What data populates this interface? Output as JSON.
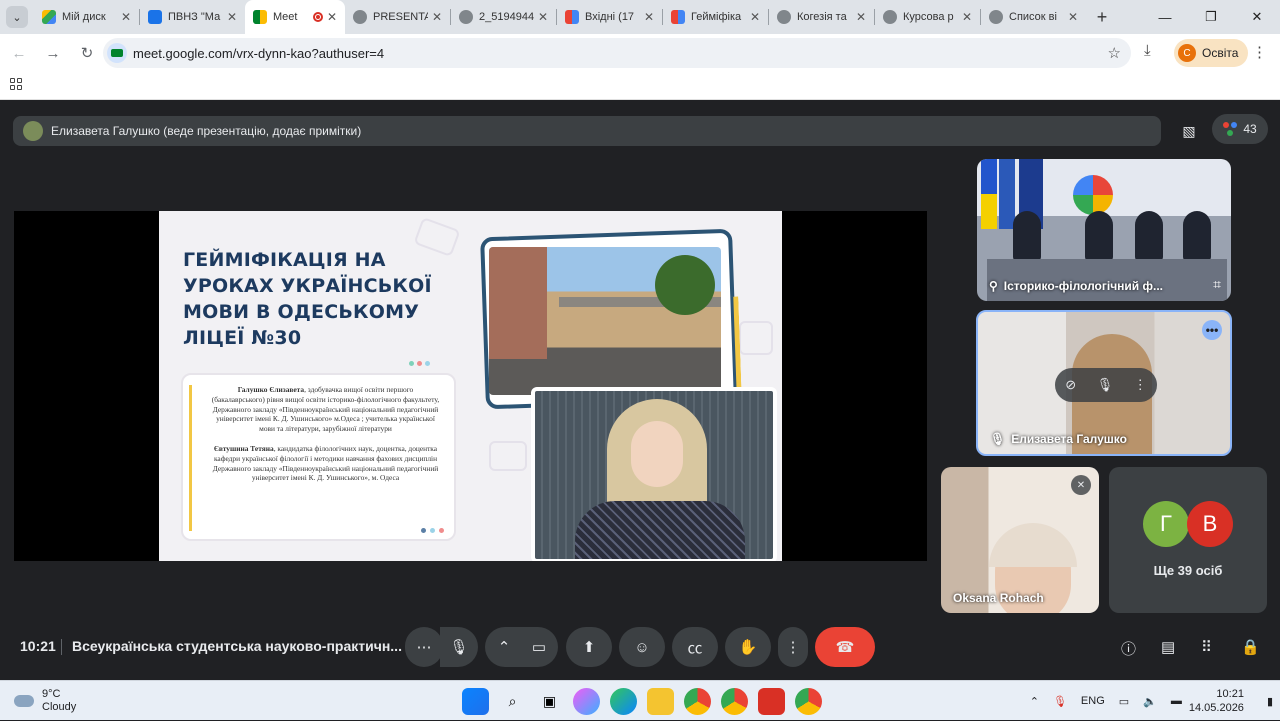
{
  "browser": {
    "tabs": [
      {
        "label": "Мій диск",
        "color": "#34a853"
      },
      {
        "label": "ПВНЗ \"Ма",
        "color": "#1a73e8"
      },
      {
        "label": "Meet",
        "color": "#00832d",
        "active": true
      },
      {
        "label": "PRESENTA",
        "color": "#5f6368"
      },
      {
        "label": "2_5194944",
        "color": "#5f6368"
      },
      {
        "label": "Вхідні (17",
        "color": "#ea4335"
      },
      {
        "label": "Гейміфіка",
        "color": "#ea4335"
      },
      {
        "label": "Когезія та",
        "color": "#5f6368"
      },
      {
        "label": "Курсова р",
        "color": "#5f6368"
      },
      {
        "label": "Список ві",
        "color": "#5f6368"
      }
    ],
    "url": "meet.google.com/vrx-dynn-kao?authuser=4",
    "profile_label": "Освіта",
    "profile_initial": "С"
  },
  "meet": {
    "presenter_banner": "Елизавета Галушко (веде презентацію, додає примітки)",
    "participant_count": "43",
    "slide": {
      "title": "ГЕЙМІФІКАЦІЯ НА УРОКАХ УКРАЇНСЬКОЇ МОВИ В ОДЕСЬКОМУ ЛІЦЕЇ №30",
      "author1_name": "Галушко Єлизавета",
      "author1_text": ", здобувачка вищої освіти першого (бакалаврського) рівня вищої освіти історико-філологічного факультету, Державного закладу «Південноукраїнський національний педагогічний університет імені К. Д. Ушинського» м.Одеса ; учителька української мови та літератури, зарубіжної літератури",
      "author2_name": "Євтушина Тетяна",
      "author2_text": ", кандидатка філологічних наук, доцентка, доцентка кафедри української філології і методики навчання фахових дисциплін Державного закладу «Південноукраїнський національний педагогічний університет імені К. Д. Ушинського», м. Одеса"
    },
    "tiles": {
      "room_name": "Історико-філологічний ф...",
      "speaker_name": "Елизавета Галушко",
      "third_name": "Oksana Rohach",
      "avatar1": "Г",
      "avatar2": "В",
      "more_label": "Ще 39 осіб"
    },
    "time": "10:21",
    "meeting_title": "Всеукраїнська студентська науково-практичн..."
  },
  "taskbar": {
    "temperature": "9°C",
    "weather": "Cloudy",
    "language": "ENG",
    "clock_time": "10:21",
    "clock_date": "14.05.2026"
  },
  "colors": {
    "meet_bg": "#202124",
    "control_bg": "#3c4043",
    "end_call": "#ea4335",
    "slide_title": "#1d3a5f",
    "accent_yellow": "#f2c744"
  }
}
